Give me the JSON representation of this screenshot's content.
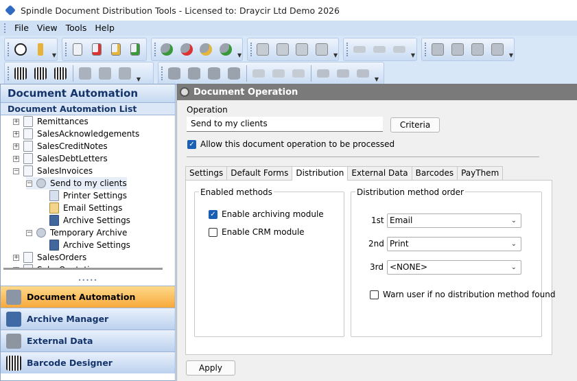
{
  "window": {
    "title": "Spindle Document Distribution Tools - Licensed to: Draycir Ltd Demo 2026"
  },
  "menu": [
    "File",
    "View",
    "Tools",
    "Help"
  ],
  "toolbar_icons": {
    "row1": [
      "info-icon",
      "key-icon",
      "add-document-icon",
      "delete-document-icon",
      "edit-document-icon",
      "refresh-document-icon",
      "add-gear-icon",
      "delete-gear-icon",
      "edit-gear-icon",
      "refresh-gear-icon",
      "add-form-icon",
      "delete-form-icon",
      "edit-form-icon",
      "copy-form-icon",
      "add-printer-icon",
      "delete-printer-icon",
      "edit-printer-icon",
      "add-server-icon",
      "delete-server-icon",
      "edit-server-icon",
      "config-server-icon"
    ],
    "row2": [
      "add-barcode-icon",
      "delete-barcode-icon",
      "edit-barcode-icon",
      "add-grid-icon",
      "delete-grid-icon",
      "edit-grid-icon",
      "add-database-icon",
      "delete-database-icon",
      "edit-database-icon",
      "refresh-database-icon",
      "add-folder-icon",
      "delete-folder-icon",
      "edit-folder-icon",
      "add-network-icon",
      "delete-network-icon",
      "edit-network-icon"
    ]
  },
  "left_panel": {
    "header": "Document Automation",
    "list_title": "Document Automation List",
    "tree": [
      {
        "label": "Remittances",
        "icon": "document-gear-icon",
        "expander": "+"
      },
      {
        "label": "SalesAcknowledgements",
        "icon": "document-gear-icon",
        "expander": "+"
      },
      {
        "label": "SalesCreditNotes",
        "icon": "document-gear-icon",
        "expander": "+"
      },
      {
        "label": "SalesDebtLetters",
        "icon": "document-gear-icon",
        "expander": "+"
      },
      {
        "label": "SalesInvoices",
        "icon": "document-gear-icon",
        "expander": "−"
      },
      {
        "label": "Send to my clients",
        "icon": "operation-gear-icon",
        "expander": "−"
      },
      {
        "label": "Printer Settings",
        "icon": "printer-icon",
        "expander": ""
      },
      {
        "label": "Email Settings",
        "icon": "email-icon",
        "expander": ""
      },
      {
        "label": "Archive Settings",
        "icon": "archive-icon",
        "expander": ""
      },
      {
        "label": "Temporary Archive",
        "icon": "operation-gear-icon",
        "expander": "−"
      },
      {
        "label": "Archive Settings",
        "icon": "archive-icon",
        "expander": ""
      },
      {
        "label": "SalesOrders",
        "icon": "document-gear-icon",
        "expander": "+"
      },
      {
        "label": "SalesQuotations",
        "icon": "document-gear-icon",
        "expander": "+"
      }
    ],
    "nav_buttons": [
      {
        "label": "Document Automation",
        "icon": "gear-icon",
        "active": true
      },
      {
        "label": "Archive Manager",
        "icon": "archive-icon",
        "active": false
      },
      {
        "label": "External Data",
        "icon": "database-icon",
        "active": false
      },
      {
        "label": "Barcode Designer",
        "icon": "barcode-icon",
        "active": false
      }
    ]
  },
  "right_panel": {
    "header": "Document Operation",
    "operation_label": "Operation",
    "operation_value": "Send to my clients",
    "criteria_button": "Criteria",
    "allow_checkbox": {
      "label": "Allow this document operation to be processed",
      "checked": true
    },
    "tabs": [
      {
        "label": "Settings",
        "active": false
      },
      {
        "label": "Default Forms",
        "active": false
      },
      {
        "label": "Distribution",
        "active": true
      },
      {
        "label": "External Data",
        "active": false
      },
      {
        "label": "Barcodes",
        "active": false
      },
      {
        "label": "PayThem",
        "active": false
      }
    ],
    "enabled_methods": {
      "title": "Enabled methods",
      "archiving": {
        "label": "Enable archiving module",
        "checked": true
      },
      "crm": {
        "label": "Enable CRM module",
        "checked": false
      }
    },
    "order": {
      "title": "Distribution method order",
      "rows": [
        {
          "label": "1st",
          "value": "Email"
        },
        {
          "label": "2nd",
          "value": "Print"
        },
        {
          "label": "3rd",
          "value": "<NONE>"
        }
      ],
      "warn": {
        "label": "Warn user if no distribution method found",
        "checked": false
      }
    },
    "apply_button": "Apply"
  }
}
